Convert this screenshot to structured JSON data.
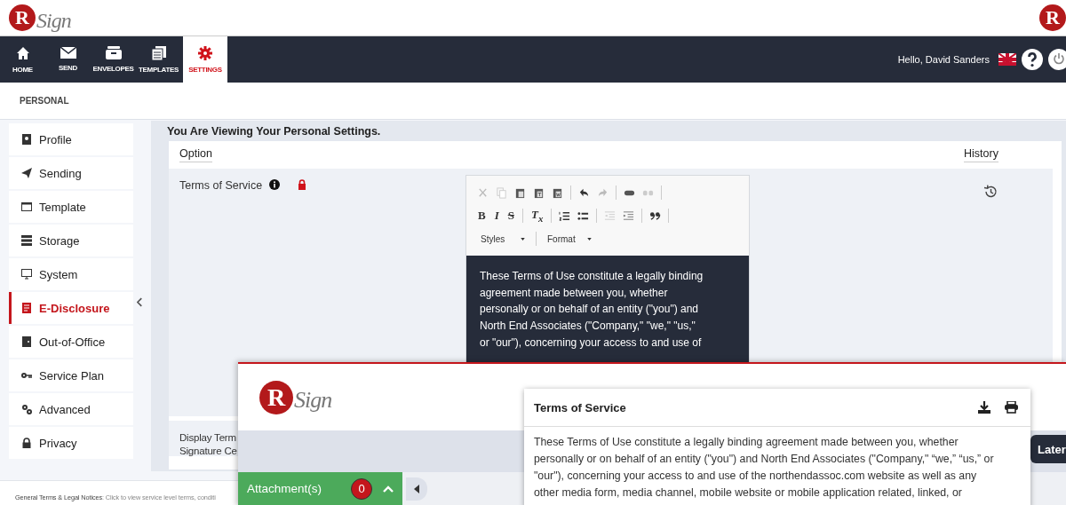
{
  "header": {
    "logo": {
      "mark": "R",
      "word": "Sign"
    },
    "corner_logo": {
      "mark": "R"
    }
  },
  "nav": {
    "items": [
      {
        "label": "HOME",
        "selected": false
      },
      {
        "label": "SEND",
        "selected": false
      },
      {
        "label": "ENVELOPES",
        "selected": false
      },
      {
        "label": "TEMPLATES",
        "selected": false
      },
      {
        "label": "SETTINGS",
        "selected": true
      }
    ],
    "greeting": "Hello, David Sanders"
  },
  "section_title": "PERSONAL",
  "sidebar": {
    "items": [
      {
        "label": "Profile",
        "selected": false
      },
      {
        "label": "Sending",
        "selected": false
      },
      {
        "label": "Template",
        "selected": false
      },
      {
        "label": "Storage",
        "selected": false
      },
      {
        "label": "System",
        "selected": false
      },
      {
        "label": "E-Disclosure",
        "selected": true
      },
      {
        "label": "Out-of-Office",
        "selected": false
      },
      {
        "label": "Service Plan",
        "selected": false
      },
      {
        "label": "Advanced",
        "selected": false
      },
      {
        "label": "Privacy",
        "selected": false
      }
    ]
  },
  "settings": {
    "heading": "You Are Viewing Your Personal Settings.",
    "columns": [
      "Option",
      "History"
    ],
    "rows": [
      {
        "kind": "editor",
        "option": "Terms of Service",
        "locked": true,
        "editor": {
          "format_buttons": [
            "B",
            "I",
            "S",
            "*T*$_{x}$"
          ],
          "dropdowns": [
            "Styles",
            "Format"
          ],
          "lines": [
            "These Terms of Use constitute a legally binding",
            "agreement made between you, whether",
            "personally or on behalf of an entity (\"you\") and",
            "North End Associates (\"Company,\" \"we,\" \"us,\"",
            "or \"our\"), concerning your access to and use of"
          ]
        }
      },
      {
        "kind": "plain",
        "option_lines": [
          "Display Term",
          "Signature Ce"
        ]
      }
    ]
  },
  "footer": {
    "text": "**General Terms & Legal Notices**: Click to view service level terms, conditi"
  },
  "overlay": {
    "logo": {
      "mark": "R",
      "word": "Sign"
    },
    "attachments": {
      "label": "Attachment(s)",
      "count": "0"
    },
    "later_button": "Later",
    "dialog": {
      "title": "Terms of Service",
      "lines": [
        "These Terms of Use constitute a legally binding agreement made between you, whether",
        "personally or on behalf of an entity (\"you\") and North End Associates (\"Company,\" “we,” “us,” or",
        "\"our\"), concerning your access to and use of the northendassoc.com website as well as any",
        "other media form, media channel, mobile website or mobile application related, linked, or"
      ]
    }
  }
}
